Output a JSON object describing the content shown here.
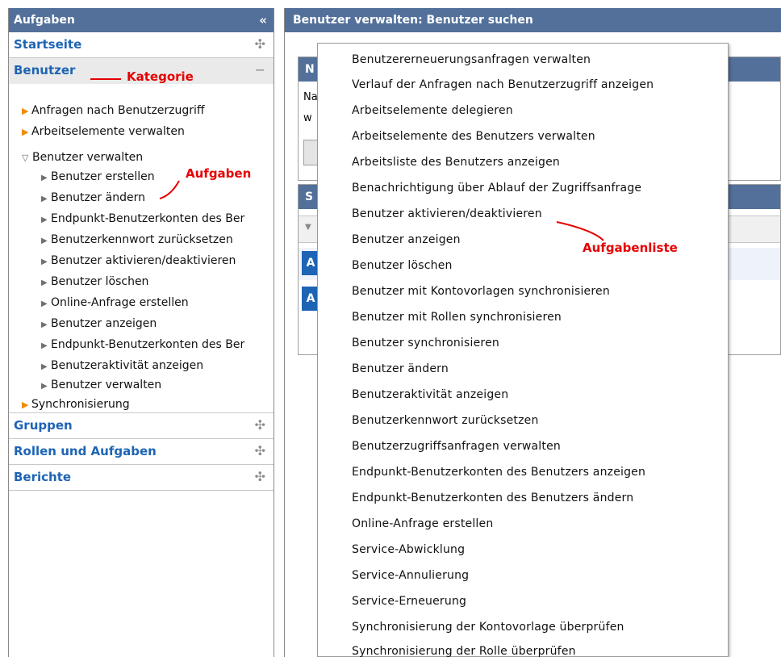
{
  "nav": {
    "header": "Aufgaben",
    "collapse_glyph": "«",
    "categories": {
      "home": "Startseite",
      "users": "Benutzer",
      "groups": "Gruppen",
      "roles": "Rollen und Aufgaben",
      "reports": "Berichte"
    },
    "tree": {
      "requests": "Anfragen nach Benutzerzugriff",
      "work_items": "Arbeitselemente verwalten",
      "manage_users": "Benutzer verwalten",
      "tasks": [
        "Benutzer erstellen",
        "Benutzer ändern",
        "Endpunkt-Benutzerkonten des Ber",
        "Benutzerkennwort zurücksetzen",
        "Benutzer aktivieren/deaktivieren",
        "Benutzer löschen",
        "Online-Anfrage erstellen",
        "Benutzer anzeigen",
        "Endpunkt-Benutzerkonten des Ber",
        "Benutzeraktivität anzeigen",
        "Benutzer verwalten"
      ],
      "sync": "Synchronisierung"
    }
  },
  "annotations": {
    "category": "Kategorie",
    "tasks": "Aufgaben",
    "task_list": "Aufgabenliste"
  },
  "main": {
    "title": "Benutzer verwalten: Benutzer suchen",
    "box1": {
      "header": "N",
      "row1": "Na",
      "row2": "w"
    },
    "box2": {
      "header": "S",
      "button1": "A",
      "button2": "A"
    }
  },
  "task_menu": [
    "Benutzererneuerungsanfragen verwalten",
    "Verlauf der Anfragen nach Benutzerzugriff anzeigen",
    "Arbeitselemente delegieren",
    "Arbeitselemente des Benutzers verwalten",
    "Arbeitsliste des Benutzers anzeigen",
    "Benachrichtigung über Ablauf der Zugriffsanfrage",
    "Benutzer aktivieren/deaktivieren",
    "Benutzer anzeigen",
    "Benutzer löschen",
    "Benutzer mit Kontovorlagen synchronisieren",
    "Benutzer mit Rollen synchronisieren",
    "Benutzer synchronisieren",
    "Benutzer ändern",
    "Benutzeraktivität anzeigen",
    "Benutzerkennwort zurücksetzen",
    "Benutzerzugriffsanfragen verwalten",
    "Endpunkt-Benutzerkonten des Benutzers anzeigen",
    "Endpunkt-Benutzerkonten des Benutzers ändern",
    "Online-Anfrage erstellen",
    "Service-Abwicklung",
    "Service-Annulierung",
    "Service-Erneuerung",
    "Synchronisierung der Kontovorlage überprüfen",
    "Synchronisierung der Rolle überprüfen"
  ],
  "colors": {
    "header_bg": "#52709a",
    "link_blue": "#1e64b4",
    "annotation_red": "#e60000",
    "tree_arrow": "#f08c00"
  }
}
